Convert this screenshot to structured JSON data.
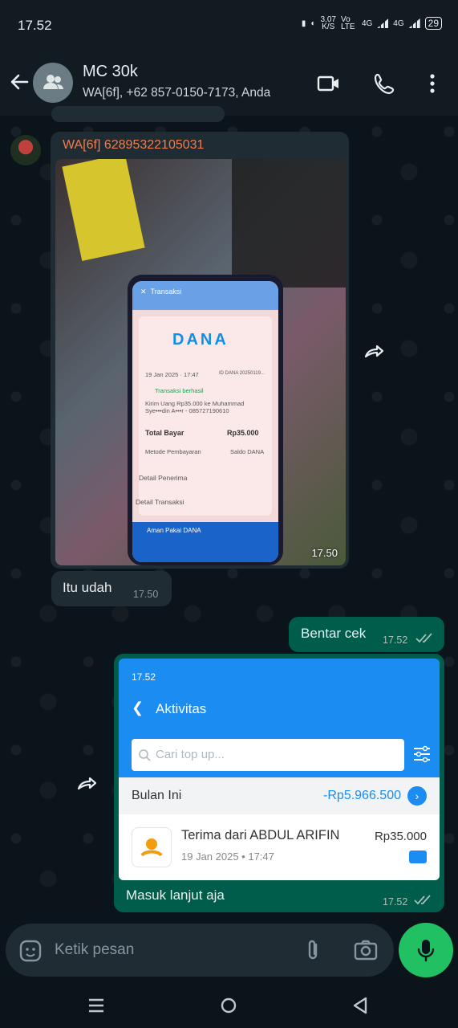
{
  "status_bar": {
    "time": "17.52",
    "net_speed": "3,07",
    "net_unit": "K/S",
    "volte": "Vo LTE",
    "sig1": "4G",
    "sig2": "4G",
    "battery": "29"
  },
  "header": {
    "title": "MC 30k",
    "subtitle": "WA[6f], +62 857-0150-7173, Anda"
  },
  "messages": {
    "m1": {
      "sender": "WA[6f] 62895322105031",
      "time": "17.50",
      "photo_content": {
        "app_title": "Transaksi",
        "logo": "DANA",
        "date_left": "19 Jan 2025 · 17:47",
        "ref_right": "ID DANA 20250119...",
        "status": "Transaksi berhasil",
        "desc": "Kirim Uang Rp35.000 ke Muhammad Sye•••din A•••r - 085727190610",
        "total_label": "Total Bayar",
        "total_value": "Rp35.000",
        "method_label": "Metode Pembayaran",
        "method_value": "Saldo DANA",
        "detail_recipient": "Detail Penerima",
        "detail_tx": "Detail Transaksi",
        "banner": "Aman Pakai DANA"
      }
    },
    "m2": {
      "text": "Itu udah",
      "time": "17.50"
    },
    "m3": {
      "text": "Bentar cek",
      "time": "17.52"
    },
    "m4": {
      "caption": "Masuk lanjut aja",
      "time": "17.52",
      "screenshot": {
        "status_time": "17.52",
        "title": "Aktivitas",
        "search_placeholder": "Cari top up...",
        "month_label": "Bulan Ini",
        "month_total": "-Rp5.966.500",
        "row_name": "Terima dari ABDUL ARIFIN",
        "row_date": "19 Jan 2025 • 17:47",
        "row_amount": "Rp35.000"
      }
    }
  },
  "composer": {
    "placeholder": "Ketik pesan"
  }
}
